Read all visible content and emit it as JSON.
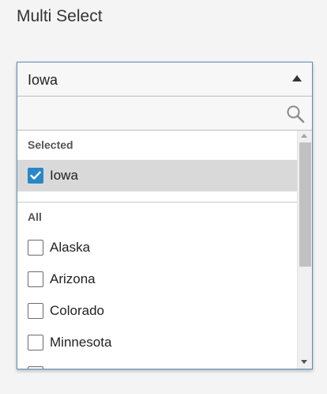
{
  "page": {
    "title": "Multi Select"
  },
  "select": {
    "value": "Iowa",
    "search_placeholder": ""
  },
  "sections": {
    "selected_header": "Selected",
    "all_header": "All"
  },
  "selected_items": [
    {
      "label": "Iowa",
      "checked": true
    }
  ],
  "all_items": [
    {
      "label": "Alaska",
      "checked": false
    },
    {
      "label": "Arizona",
      "checked": false
    },
    {
      "label": "Colorado",
      "checked": false
    },
    {
      "label": "Minnesota",
      "checked": false
    }
  ],
  "colors": {
    "accent": "#2a86c8",
    "border_focus": "#5b8db5",
    "selected_row": "#d9d9d9"
  },
  "icons": {
    "dropdown": "caret-up-icon",
    "search": "search-icon",
    "check": "checkmark-icon"
  }
}
